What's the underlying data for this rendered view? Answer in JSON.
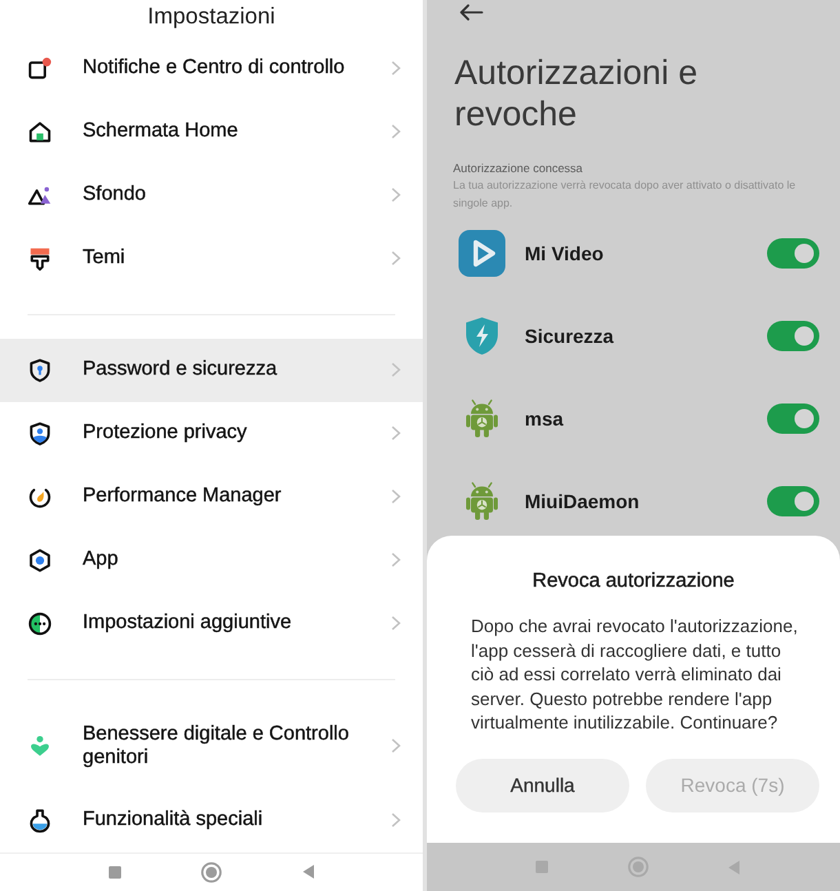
{
  "settings": {
    "title": "Impostazioni",
    "groups": [
      {
        "items": [
          {
            "label": "Notifiche e Centro di controllo",
            "selected": false
          },
          {
            "label": "Schermata Home",
            "selected": false
          },
          {
            "label": "Sfondo",
            "selected": false
          },
          {
            "label": "Temi",
            "selected": false
          }
        ]
      },
      {
        "items": [
          {
            "label": "Password e sicurezza",
            "selected": true
          },
          {
            "label": "Protezione privacy",
            "selected": false
          },
          {
            "label": "Performance Manager",
            "selected": false
          },
          {
            "label": "App",
            "selected": false
          },
          {
            "label": "Impostazioni aggiuntive",
            "selected": false
          }
        ]
      },
      {
        "items": [
          {
            "label": "Benessere digitale e Controllo genitori",
            "selected": false
          },
          {
            "label": "Funzionalità speciali",
            "selected": false
          }
        ]
      }
    ]
  },
  "permissions": {
    "title": "Autorizzazioni e revoche",
    "section_title": "Autorizzazione concessa",
    "section_note": "La tua autorizzazione verrà revocata dopo aver attivato o disattivato le singole app.",
    "apps": [
      {
        "name": "Mi Video",
        "on": true
      },
      {
        "name": "Sicurezza",
        "on": true
      },
      {
        "name": "msa",
        "on": true
      },
      {
        "name": "MiuiDaemon",
        "on": true
      }
    ]
  },
  "dialog": {
    "title": "Revoca autorizzazione",
    "message": "Dopo che avrai revocato l'autorizzazione, l'app cesserà di raccogliere dati, e tutto ciò ad essi correlato verrà eliminato dai server. Questo potrebbe rendere l'app virtualmente inutilizzabile. Continuare?",
    "buttons": [
      {
        "label": "Annulla",
        "disabled": false
      },
      {
        "label": "Revoca (7s)",
        "disabled": true
      }
    ]
  }
}
